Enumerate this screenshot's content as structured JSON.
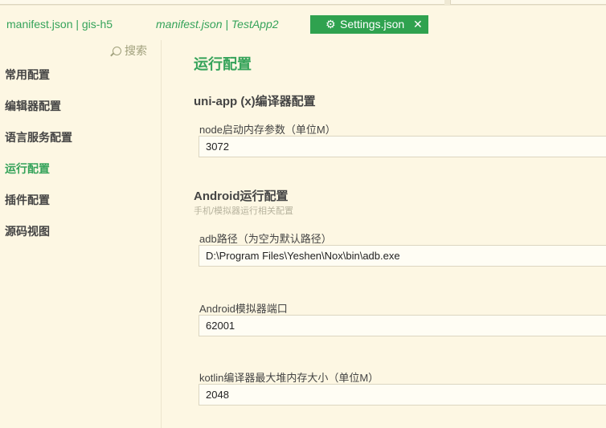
{
  "tabs": [
    {
      "label": "manifest.json | gis-h5"
    },
    {
      "label": "manifest.json | TestApp2"
    }
  ],
  "active_tab": {
    "icon": "gear-icon",
    "label": "Settings.json",
    "close": "✕"
  },
  "sidebar": {
    "search_label": "搜索",
    "items": [
      {
        "label": "常用配置",
        "active": false
      },
      {
        "label": "编辑器配置",
        "active": false
      },
      {
        "label": "语言服务配置",
        "active": false
      },
      {
        "label": "运行配置",
        "active": true
      },
      {
        "label": "插件配置",
        "active": false
      },
      {
        "label": "源码视图",
        "active": false
      }
    ]
  },
  "main": {
    "title": "运行配置",
    "sections": [
      {
        "title": "uni-app (x)编译器配置",
        "fields": [
          {
            "label": "node启动内存参数（单位M）",
            "value": "3072"
          }
        ]
      },
      {
        "title": "Android运行配置",
        "subtitle": "手机/模拟器运行相关配置",
        "fields": [
          {
            "label": "adb路径（为空为默认路径）",
            "value": "D:\\Program Files\\Yeshen\\Nox\\bin\\adb.exe"
          },
          {
            "label": "Android模拟器端口",
            "value": "62001"
          },
          {
            "label": "kotlin编译器最大堆内存大小（单位M）",
            "value": "2048"
          }
        ]
      }
    ]
  },
  "colors": {
    "accent": "#35a35a",
    "active_tab_bg": "#2fa24f",
    "background": "#fdf7e3",
    "input_bg": "#fffdf4"
  }
}
